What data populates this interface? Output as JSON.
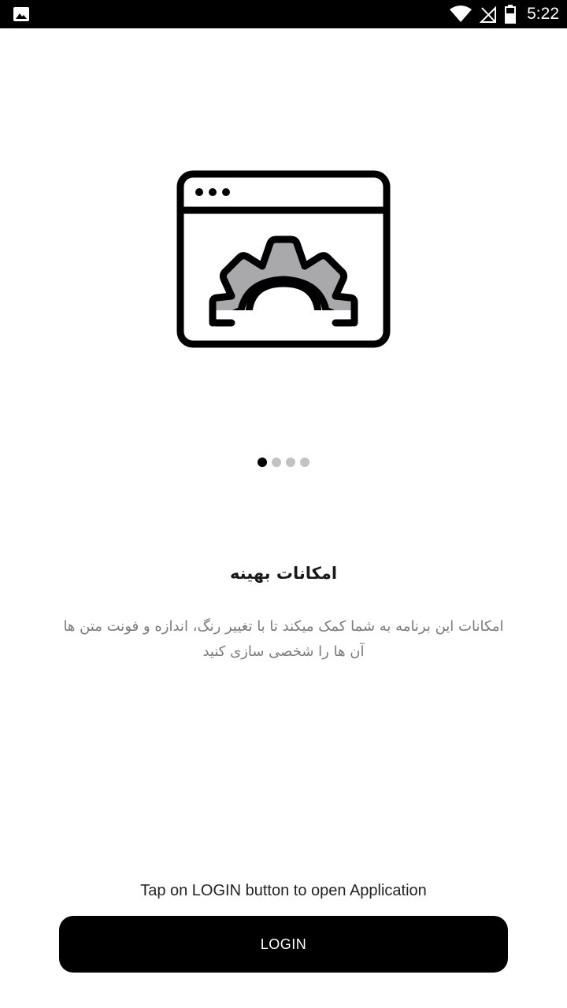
{
  "status_bar": {
    "time": "5:22",
    "left_icon": "image-icon",
    "icons": [
      "wifi-icon",
      "no-signal-icon",
      "battery-icon"
    ]
  },
  "onboarding": {
    "illustration_icon": "browser-settings-icon",
    "page_indicator": {
      "total": 4,
      "active_index": 0
    },
    "title": "امکانات بهینه",
    "description_line1": "امکانات این برنامه به شما کمک میکند تا با تغییر رنگ، اندازه و فونت متن ها",
    "description_line2": "آن ها را شخصی سازی کنید"
  },
  "footer": {
    "hint": "Tap on LOGIN button to open Application",
    "login_label": "LOGIN"
  },
  "colors": {
    "status_bar_bg": "#000000",
    "button_bg": "#000000",
    "gear_fill": "#a9a9ab",
    "dot_active": "#000000",
    "dot_inactive": "#c2c2c2",
    "description_text": "#7a7a7a"
  }
}
